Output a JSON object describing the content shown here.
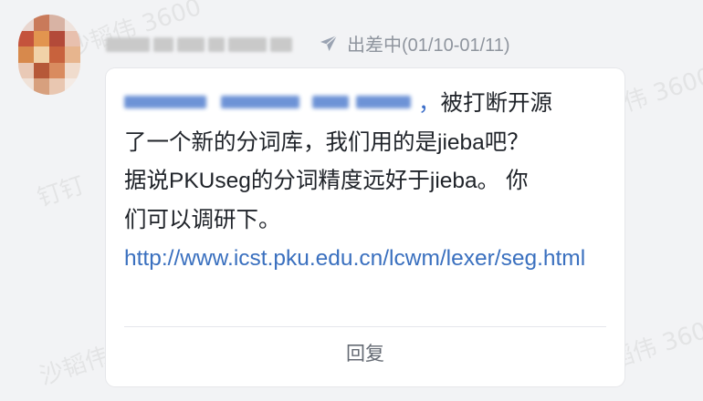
{
  "watermark": {
    "text_a": "沙韬伟 3600",
    "text_b": "钉钉"
  },
  "sender": {
    "status_text": "出差中(01/10-01/11)",
    "status_icon": "airplane-icon"
  },
  "message": {
    "mention_comma": "，",
    "line1_rest": "被打断开源",
    "line2": "了一个新的分词库，我们用的是jieba吧？",
    "line3": "据说PKUseg的分词精度远好于jieba。 你",
    "line4": "们可以调研下。",
    "link": "http://www.icst.pku.edu.cn/lcwm/lexer/seg.html"
  },
  "actions": {
    "reply_label": "回复"
  },
  "colors": {
    "link": "#3a70bf",
    "text": "#1f2329",
    "muted": "#8f959e",
    "background": "#f2f3f5"
  }
}
